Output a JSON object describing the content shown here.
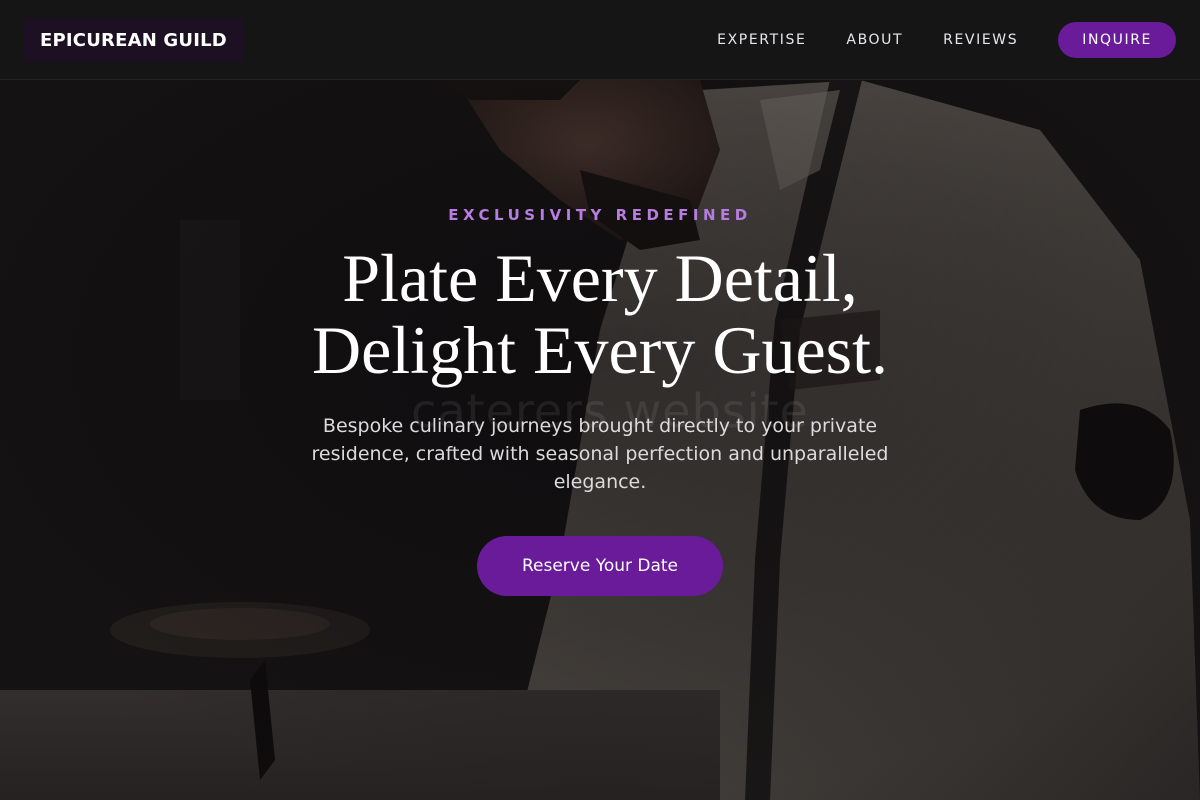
{
  "header": {
    "brand": "EPICUREAN GUILD",
    "nav": [
      {
        "label": "EXPERTISE"
      },
      {
        "label": "ABOUT"
      },
      {
        "label": "REVIEWS"
      }
    ],
    "cta_label": "INQUIRE"
  },
  "hero": {
    "eyebrow": "EXCLUSIVITY REDEFINED",
    "headline_line1": "Plate Every Detail,",
    "headline_line2": "Delight Every Guest.",
    "subtext": "Bespoke culinary journeys brought directly to your private residence, crafted with seasonal perfection and unparalleled elegance.",
    "cta_label": "Reserve Your Date",
    "watermark": "caterers website"
  },
  "colors": {
    "accent": "#6a1b9a",
    "eyebrow": "#b77de0",
    "header_bg": "#161516"
  }
}
